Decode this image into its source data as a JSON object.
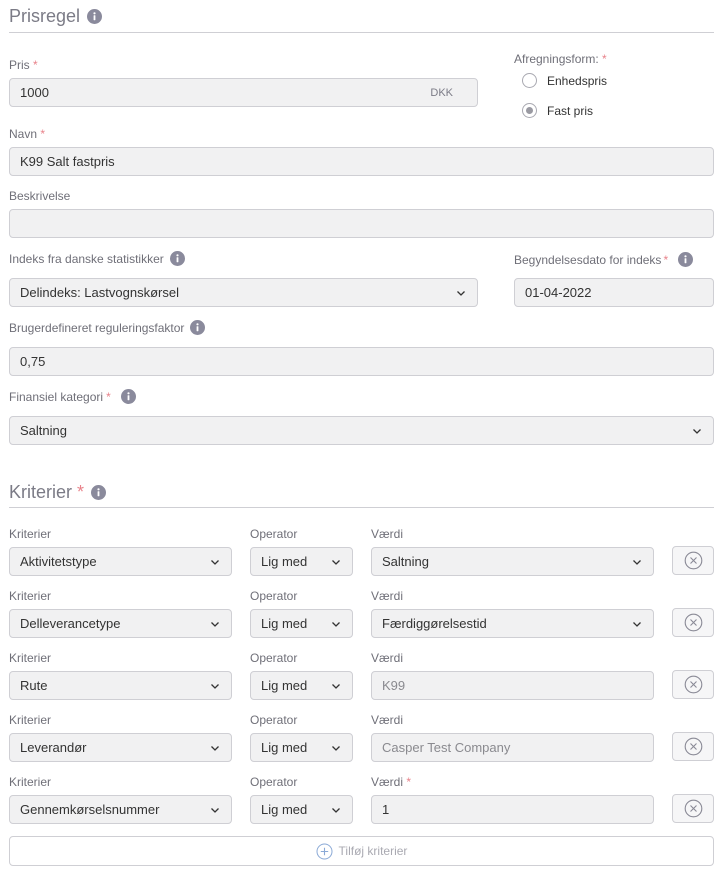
{
  "prisregel": {
    "title": "Prisregel",
    "pris": {
      "label": "Pris",
      "value": "1000",
      "unit": "DKK"
    },
    "afregningsform": {
      "label": "Afregningsform:",
      "options": [
        {
          "label": "Enhedspris",
          "checked": false
        },
        {
          "label": "Fast pris",
          "checked": true
        }
      ]
    },
    "navn": {
      "label": "Navn",
      "value": "K99 Salt fastpris"
    },
    "beskrivelse": {
      "label": "Beskrivelse",
      "value": ""
    },
    "indeks": {
      "label": "Indeks fra danske statistikker",
      "value": "Delindeks: Lastvognskørsel"
    },
    "begyndelsesdato": {
      "label": "Begyndelsesdato for indeks",
      "value": "01-04-2022"
    },
    "reguleringsfaktor": {
      "label": "Brugerdefineret reguleringsfaktor",
      "value": "0,75"
    },
    "finansiel_kategori": {
      "label": "Finansiel kategori",
      "value": "Saltning"
    }
  },
  "kriterier": {
    "title": "Kriterier",
    "rows": [
      {
        "kriterie_label": "Kriterier",
        "kriterie": "Aktivitetstype",
        "operator_label": "Operator",
        "operator": "Lig med",
        "vaerdi_label": "Værdi",
        "vaerdi_required": false,
        "vaerdi": "Saltning",
        "vaerdi_kind": "select"
      },
      {
        "kriterie_label": "Kriterier",
        "kriterie": "Delleverancetype",
        "operator_label": "Operator",
        "operator": "Lig med",
        "vaerdi_label": "Værdi",
        "vaerdi_required": false,
        "vaerdi": "Færdiggørelsestid",
        "vaerdi_kind": "select"
      },
      {
        "kriterie_label": "Kriterier",
        "kriterie": "Rute",
        "operator_label": "Operator",
        "operator": "Lig med",
        "vaerdi_label": "Værdi",
        "vaerdi_required": false,
        "vaerdi": "K99",
        "vaerdi_kind": "readonly"
      },
      {
        "kriterie_label": "Kriterier",
        "kriterie": "Leverandør",
        "operator_label": "Operator",
        "operator": "Lig med",
        "vaerdi_label": "Værdi",
        "vaerdi_required": false,
        "vaerdi": "Casper Test Company",
        "vaerdi_kind": "readonly"
      },
      {
        "kriterie_label": "Kriterier",
        "kriterie": "Gennemkørselsnummer",
        "operator_label": "Operator",
        "operator": "Lig med",
        "vaerdi_label": "Værdi",
        "vaerdi_required": true,
        "vaerdi": "1",
        "vaerdi_kind": "input"
      }
    ],
    "add_label": "Tilføj kriterier"
  },
  "icons": {
    "info": "info-icon",
    "chevron": "chevron-down-icon",
    "remove": "remove-circle-x-icon",
    "add": "add-circle-plus-icon"
  },
  "colors": {
    "required": "#e8828a",
    "field_bg": "#f1f1f2",
    "border": "#cfcfd4",
    "muted_text": "#6f6f78"
  }
}
